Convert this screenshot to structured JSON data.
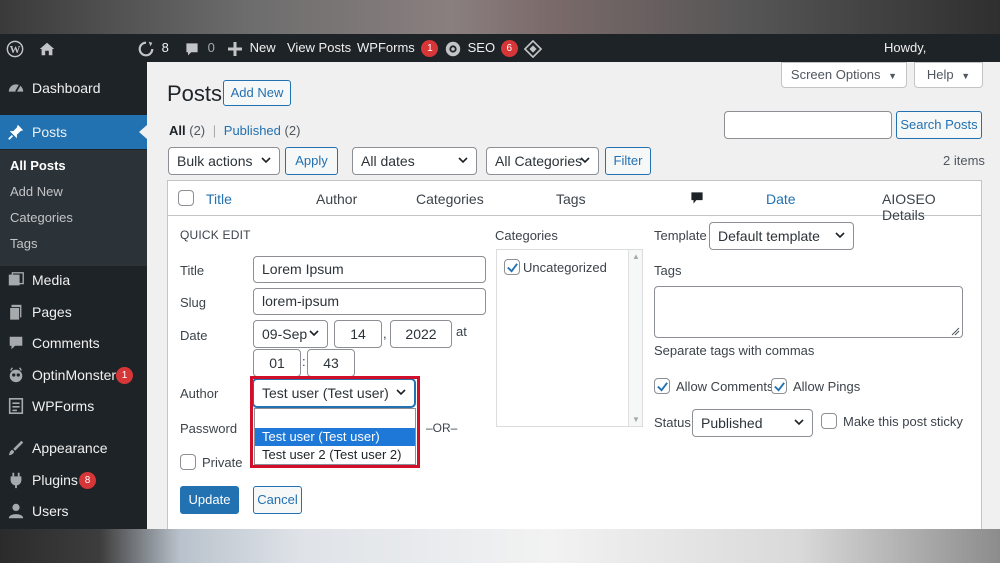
{
  "adminbar": {
    "updates_count": "8",
    "comments_count": "0",
    "new_label": "New",
    "view_posts_label": "View Posts",
    "wpforms_label": "WPForms",
    "wpforms_badge": "1",
    "seo_label": "SEO",
    "seo_badge": "6",
    "howdy_label": "Howdy,"
  },
  "sidebar": {
    "dashboard": "Dashboard",
    "posts": "Posts",
    "sub": [
      "All Posts",
      "Add New",
      "Categories",
      "Tags"
    ],
    "media": "Media",
    "pages": "Pages",
    "comments": "Comments",
    "optinmonster": "OptinMonster",
    "optinmonster_badge": "1",
    "wpforms": "WPForms",
    "appearance": "Appearance",
    "plugins": "Plugins",
    "plugins_badge": "8",
    "users": "Users"
  },
  "header": {
    "title": "Posts",
    "add_new": "Add New",
    "screen_options": "Screen Options",
    "help": "Help"
  },
  "filters": {
    "all_label": "All",
    "all_count": "(2)",
    "separator": "|",
    "published_label": "Published",
    "published_count": "(2)",
    "search_value": "",
    "search_button": "Search Posts",
    "bulk_actions": "Bulk actions",
    "apply": "Apply",
    "all_dates": "All dates",
    "all_categories": "All Categories",
    "filter": "Filter",
    "items_count": "2 items"
  },
  "table": {
    "columns": [
      "Title",
      "Author",
      "Categories",
      "Tags",
      "Date",
      "AIOSEO Details"
    ]
  },
  "quick_edit": {
    "heading": "QUICK EDIT",
    "title_label": "Title",
    "title_value": "Lorem Ipsum",
    "slug_label": "Slug",
    "slug_value": "lorem-ipsum",
    "date_label": "Date",
    "month": "09-Sep",
    "day": "14",
    "comma": ",",
    "year": "2022",
    "at": "at",
    "hour": "01",
    "colon": ":",
    "minute": "43",
    "author_label": "Author",
    "author_value": "Test user (Test user)",
    "author_options": [
      "Test user (Test user)",
      "Test user 2 (Test user 2)"
    ],
    "password_label": "Password",
    "or_label": "–OR–",
    "private_label": "Private",
    "update": "Update",
    "cancel": "Cancel",
    "categories_label": "Categories",
    "category_item": "Uncategorized",
    "template_label": "Template",
    "template_value": "Default template",
    "tags_label": "Tags",
    "tags_value": "",
    "tags_hint": "Separate tags with commas",
    "allow_comments": "Allow Comments",
    "allow_pings": "Allow Pings",
    "status_label": "Status",
    "status_value": "Published",
    "sticky_label": "Make this post sticky"
  }
}
